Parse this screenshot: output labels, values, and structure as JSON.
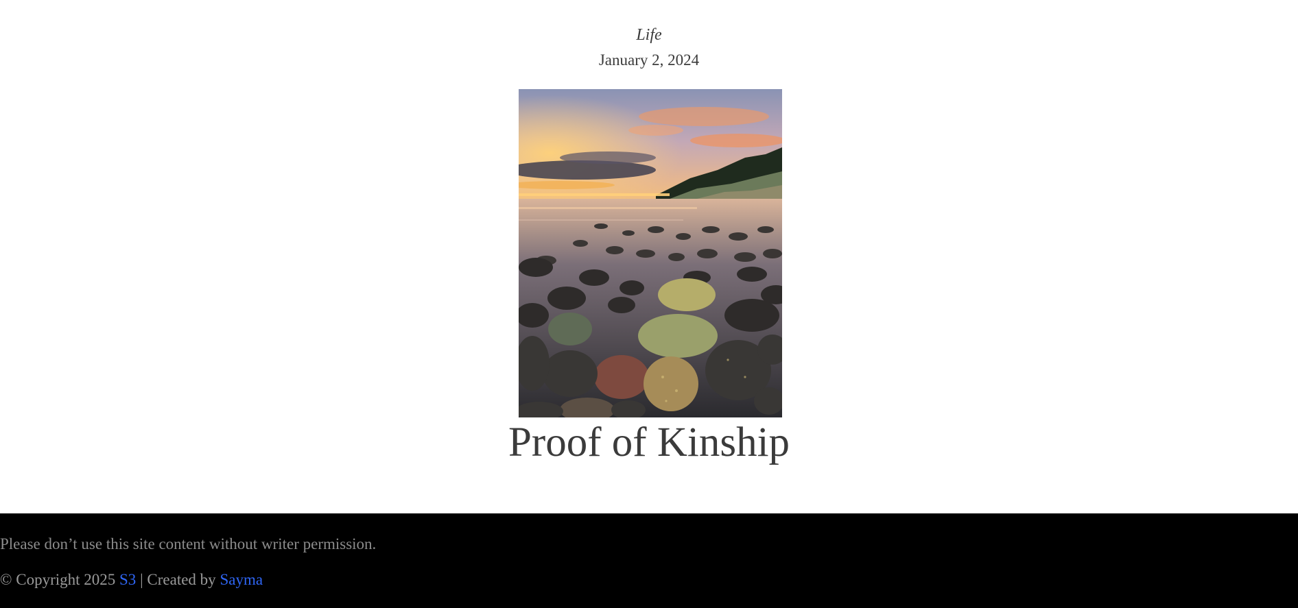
{
  "post": {
    "category": "Life",
    "date": "January 2, 2024",
    "title": "Proof of Kinship",
    "image_alt": "Rocky beach at sunset"
  },
  "footer": {
    "notice": "Please don’t use this site content without writer permission.",
    "copyright_prefix": "© Copyright 2025",
    "link_s3": "S3",
    "separator": "| Created by",
    "link_author": "Sayma",
    "link_color": "#2f66f5"
  },
  "colors": {
    "text": "#3b3b3b",
    "footer_bg": "#000000",
    "footer_text": "#8c8c8c"
  }
}
